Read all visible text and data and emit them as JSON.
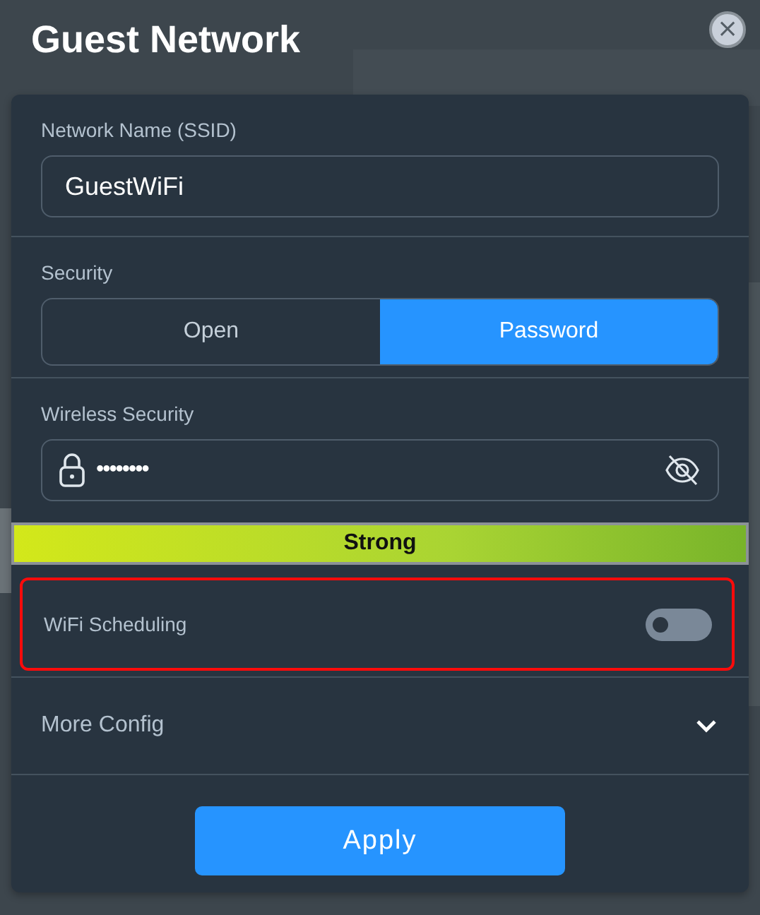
{
  "dialog": {
    "title": "Guest Network",
    "close_label": "×"
  },
  "ssid": {
    "label": "Network Name (SSID)",
    "value": "GuestWiFi"
  },
  "security": {
    "label": "Security",
    "options": [
      {
        "label": "Open",
        "selected": false
      },
      {
        "label": "Password",
        "selected": true
      }
    ]
  },
  "wireless_security": {
    "label": "Wireless Security",
    "value": "••••••••",
    "visible": false
  },
  "strength": {
    "label": "Strong",
    "level": 1
  },
  "wifi_scheduling": {
    "label": "WiFi Scheduling",
    "on": false,
    "highlighted": true
  },
  "more_config": {
    "label": "More Config",
    "expanded": false
  },
  "apply_button": "Apply"
}
